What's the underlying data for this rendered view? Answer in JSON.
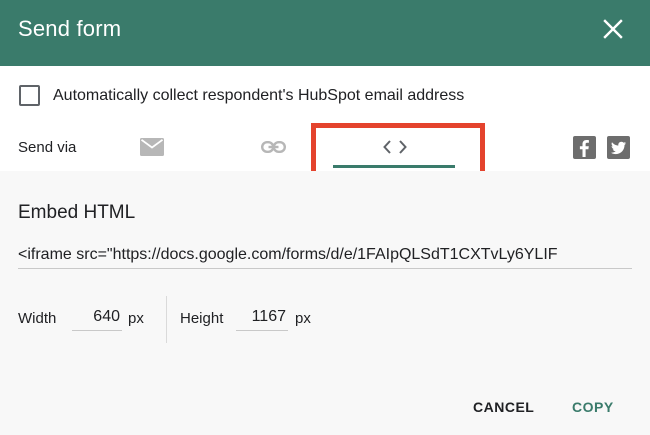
{
  "colors": {
    "accent": "#3a7b6b",
    "highlight": "#e4432d",
    "icon_gray": "#b7b7b7",
    "social_gray": "#6d6d6d"
  },
  "header": {
    "title": "Send form",
    "close_icon": "close-icon"
  },
  "collect_email": {
    "label": "Automatically collect respondent's HubSpot email address",
    "checked": false
  },
  "send_via": {
    "label": "Send via",
    "options": [
      {
        "icon": "email-icon",
        "selected": false
      },
      {
        "icon": "link-icon",
        "selected": false
      },
      {
        "icon": "embed-code-icon",
        "selected": true
      }
    ],
    "social": [
      {
        "icon": "facebook-icon"
      },
      {
        "icon": "twitter-icon"
      }
    ]
  },
  "embed": {
    "title": "Embed HTML",
    "code": "<iframe src=\"https://docs.google.com/forms/d/e/1FAIpQLSdT1CXTvLy6YLIF",
    "width_label": "Width",
    "width_value": "640",
    "height_label": "Height",
    "height_value": "1167",
    "unit": "px"
  },
  "actions": {
    "cancel_label": "CANCEL",
    "copy_label": "COPY"
  }
}
